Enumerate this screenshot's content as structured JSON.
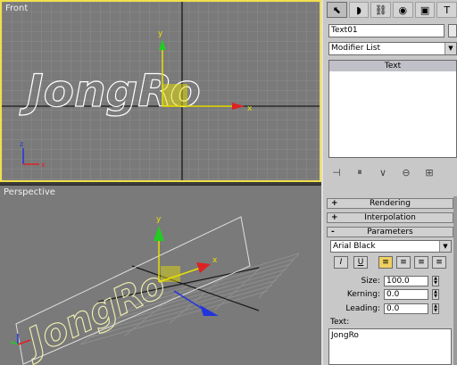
{
  "viewports": {
    "front": {
      "label": "Front",
      "gizmo": {
        "y": "y",
        "x": "x"
      },
      "corner_axes": {
        "z": "z",
        "x": "x"
      }
    },
    "perspective": {
      "label": "Perspective",
      "gizmo": {
        "y": "y",
        "x": "x"
      }
    },
    "text_shape": "JongRo"
  },
  "panel": {
    "tabs": [
      {
        "icon": "cursor-icon",
        "glyph": "⬉"
      },
      {
        "icon": "modify-icon",
        "glyph": "◗"
      },
      {
        "icon": "hierarchy-icon",
        "glyph": "⛓"
      },
      {
        "icon": "motion-icon",
        "glyph": "◉"
      },
      {
        "icon": "display-icon",
        "glyph": "▣"
      },
      {
        "icon": "utilities-icon",
        "glyph": "T"
      }
    ],
    "object_name": "Text01",
    "modifier_list": "Modifier List",
    "stack_items": [
      "Text"
    ],
    "stack_tools": [
      "⊣",
      "⏸",
      "∨",
      "⊖",
      "⊞"
    ],
    "rollouts": [
      {
        "sign": "+",
        "title": "Rendering"
      },
      {
        "sign": "+",
        "title": "Interpolation"
      },
      {
        "sign": "-",
        "title": "Parameters"
      }
    ],
    "font": "Arial Black",
    "format_buttons": [
      "I",
      "U",
      "≡",
      "≡",
      "≡",
      "≡"
    ],
    "size_label": "Size:",
    "size_value": "100.0",
    "kerning_label": "Kerning:",
    "kerning_value": "0.0",
    "leading_label": "Leading:",
    "leading_value": "0.0",
    "text_label": "Text:",
    "text_value": "JongRo"
  },
  "colors": {
    "viewport_bg": "#7a7a7a",
    "active_border": "#f0e04a",
    "grid": "#8a8a8a",
    "axis_y": "#22cc22",
    "axis_x": "#dd2222",
    "gizmo_z": "#2233dd"
  }
}
